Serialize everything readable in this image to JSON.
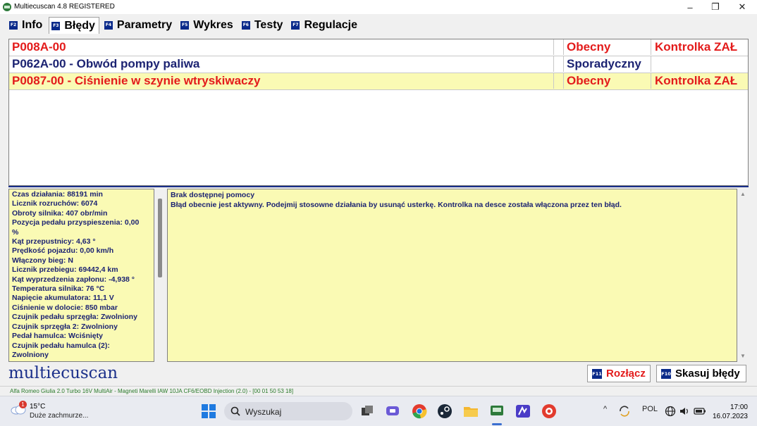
{
  "window": {
    "title": "Multiecuscan 4.8 REGISTERED",
    "minimize": "–",
    "maximize": "❐",
    "close": "✕"
  },
  "tabs": [
    {
      "key": "F2",
      "label": "Info",
      "active": false
    },
    {
      "key": "F3",
      "label": "Błędy",
      "active": true
    },
    {
      "key": "F4",
      "label": "Parametry",
      "active": false
    },
    {
      "key": "F5",
      "label": "Wykres",
      "active": false
    },
    {
      "key": "F6",
      "label": "Testy",
      "active": false
    },
    {
      "key": "F7",
      "label": "Regulacje",
      "active": false
    }
  ],
  "dtc": [
    {
      "code": "P008A-00",
      "status": "Obecny",
      "lamp": "Kontrolka ZAŁ",
      "color": "#e31b1b",
      "highlight": false
    },
    {
      "code": "P062A-00 - Obwód pompy paliwa",
      "status": "Sporadyczny",
      "lamp": "",
      "color": "#1c2372",
      "highlight": false
    },
    {
      "code": "P0087-00 - Ciśnienie w szynie wtryskiwaczy",
      "status": "Obecny",
      "lamp": "Kontrolka ZAŁ",
      "color": "#e31b1b",
      "highlight": true
    }
  ],
  "params": [
    "Czas działania: 88191 min",
    "Licznik rozruchów: 6074",
    "Obroty silnika: 407 obr/min",
    "Pozycja pedału przyspieszenia: 0,00",
    "%",
    "Kąt przepustnicy: 4,63 °",
    "Prędkość pojazdu: 0,00 km/h",
    "Włączony bieg: N",
    "Licznik przebiegu: 69442,4 km",
    "Kąt wyprzedzenia zapłonu: -4,938 °",
    "Temperatura silnika: 76 °C",
    "Napięcie akumulatora: 11,1 V",
    "Ciśnienie w dolocie: 850 mbar",
    "Czujnik pedału sprzęgła: Zwolniony",
    "Czujnik sprzęgła 2: Zwolniony",
    "Pedał hamulca: Wciśnięty",
    "Czujnik pedału hamulca (2):",
    "Zwolniony"
  ],
  "help": {
    "title": "Brak dostępnej pomocy",
    "text": "Błąd obecnie jest aktywny. Podejmij stosowne działania by usunąć usterkę. Kontrolka na desce została włączona przez ten błąd."
  },
  "logo": "multiecuscan",
  "buttons": {
    "disconnect": {
      "key": "F11",
      "label": "Rozłącz",
      "color": "#e31b1b"
    },
    "clear": {
      "key": "F10",
      "label": "Skasuj błędy",
      "color": "#000000"
    }
  },
  "status_bar": "Alfa Romeo Giulia 2.0 Turbo 16V MultiAir - Magneti Marelli IAW 10JA CF6/EOBD Injection (2.0) - [00 01 50 53 18]",
  "taskbar": {
    "weather_badge": "1",
    "temperature": "15°C",
    "weather": "Duże zachmurze...",
    "search_placeholder": "Wyszukaj",
    "tray_chevron": "^",
    "language": "POL",
    "time": "17:00",
    "date": "16.07.2023"
  },
  "colors": {
    "accent": "#1a2f8a",
    "error": "#e31b1b",
    "highlight": "#fafab4",
    "text_blue": "#1c2372"
  }
}
